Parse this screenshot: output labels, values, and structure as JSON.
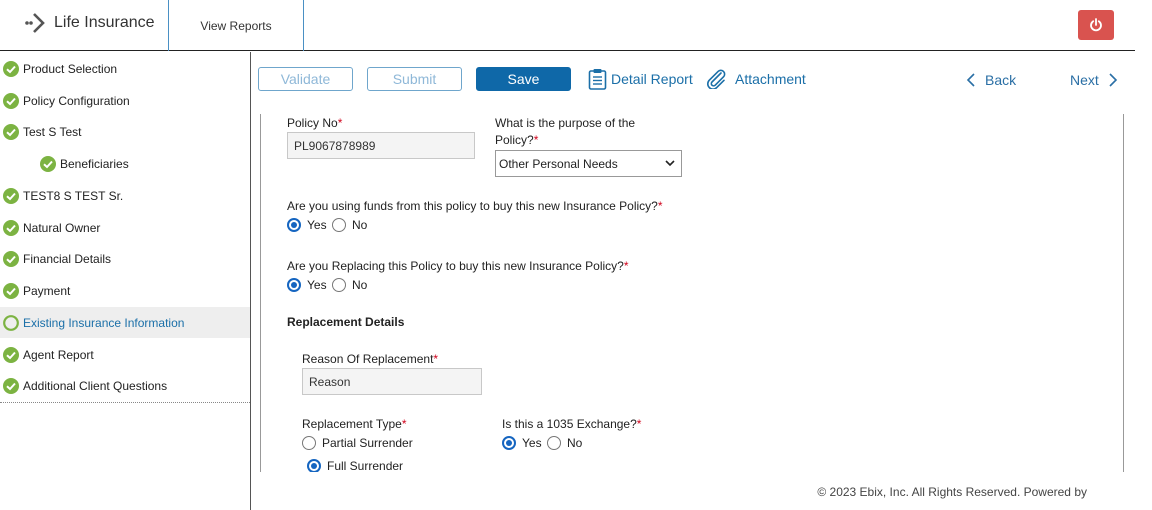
{
  "header": {
    "app_name": "Life Insurance",
    "nav_tab": "View Reports"
  },
  "sidebar": {
    "items": [
      {
        "label": "Product Selection",
        "status": "complete"
      },
      {
        "label": "Policy Configuration",
        "status": "complete"
      },
      {
        "label": "Test S Test",
        "status": "complete"
      },
      {
        "label": "Beneficiaries",
        "status": "complete"
      },
      {
        "label": "TEST8 S TEST Sr.",
        "status": "complete"
      },
      {
        "label": "Natural Owner",
        "status": "complete"
      },
      {
        "label": "Financial Details",
        "status": "complete"
      },
      {
        "label": "Payment",
        "status": "complete"
      },
      {
        "label": "Existing Insurance Information",
        "status": "current"
      },
      {
        "label": "Agent Report",
        "status": "complete"
      },
      {
        "label": "Additional Client Questions",
        "status": "complete"
      }
    ]
  },
  "toolbar": {
    "validate": "Validate",
    "submit": "Submit",
    "save": "Save",
    "detail_report": "Detail Report",
    "attachment": "Attachment",
    "back": "Back",
    "next": "Next"
  },
  "form": {
    "policy_no": {
      "label": "Policy No",
      "value": "PL9067878989"
    },
    "purpose": {
      "label_line1": "What is the purpose of the",
      "label_line2": "Policy?",
      "selected": "Other Personal Needs"
    },
    "funds_question": {
      "label": "Are you using funds from this policy to buy this new Insurance Policy?",
      "yes": "Yes",
      "no": "No",
      "selected": "Yes"
    },
    "replacing_question": {
      "label": "Are you Replacing this Policy to buy this new Insurance Policy?",
      "yes": "Yes",
      "no": "No",
      "selected": "Yes"
    },
    "replacement_section": "Replacement Details",
    "reason": {
      "label": "Reason Of Replacement",
      "value": "Reason"
    },
    "replacement_type": {
      "label": "Replacement Type",
      "options": [
        "Partial Surrender",
        "Full Surrender"
      ],
      "selected": "Full Surrender"
    },
    "exchange_1035": {
      "label": "Is this a 1035 Exchange?",
      "yes": "Yes",
      "no": "No",
      "selected": "Yes"
    },
    "required_mark": "*"
  },
  "footer": {
    "copyright": "© 2023 Ebix, Inc. All Rights Reserved. Powered by"
  },
  "colors": {
    "accent": "#0f68a8",
    "check_green": "#7cb342",
    "power_red": "#d9534f",
    "active_text": "#1a6fa8"
  }
}
